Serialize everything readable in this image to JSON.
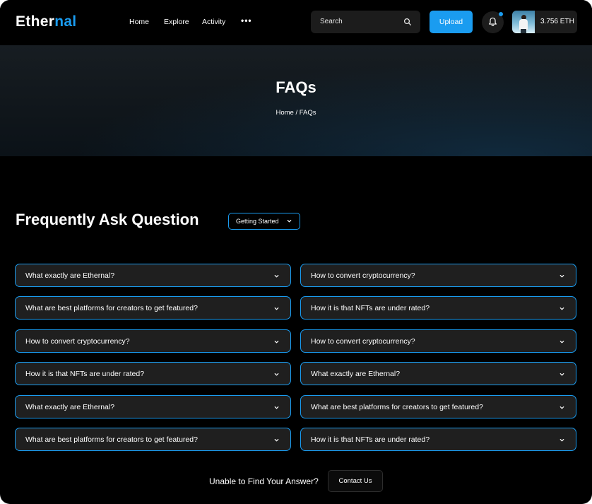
{
  "header": {
    "logo_part1": "Ether",
    "logo_part2": "nal",
    "nav": [
      "Home",
      "Explore",
      "Activity"
    ],
    "more_label": "•••",
    "search_placeholder": "Search",
    "upload_label": "Upload",
    "wallet_balance": "3.756 ETH",
    "accent_color": "#1a9cf0"
  },
  "hero": {
    "title": "FAQs",
    "breadcrumb": "Home / FAQs"
  },
  "faq_section": {
    "title": "Frequently Ask Question",
    "filter_label": "Getting Started",
    "left": [
      "What exactly are Ethernal?",
      "What are best platforms for creators to get featured?",
      "How to convert cryptocurrency?",
      "How it is that NFTs are under rated?",
      "What exactly are Ethernal?",
      "What are best platforms for creators to get featured?"
    ],
    "right": [
      "How to convert cryptocurrency?",
      "How it is that NFTs are under rated?",
      "How to convert cryptocurrency?",
      "What exactly are Ethernal?",
      "What are best platforms for creators to get featured?",
      "How it is that NFTs are under rated?"
    ]
  },
  "footer": {
    "prompt": "Unable to Find Your Answer?",
    "contact_label": "Contact Us"
  }
}
